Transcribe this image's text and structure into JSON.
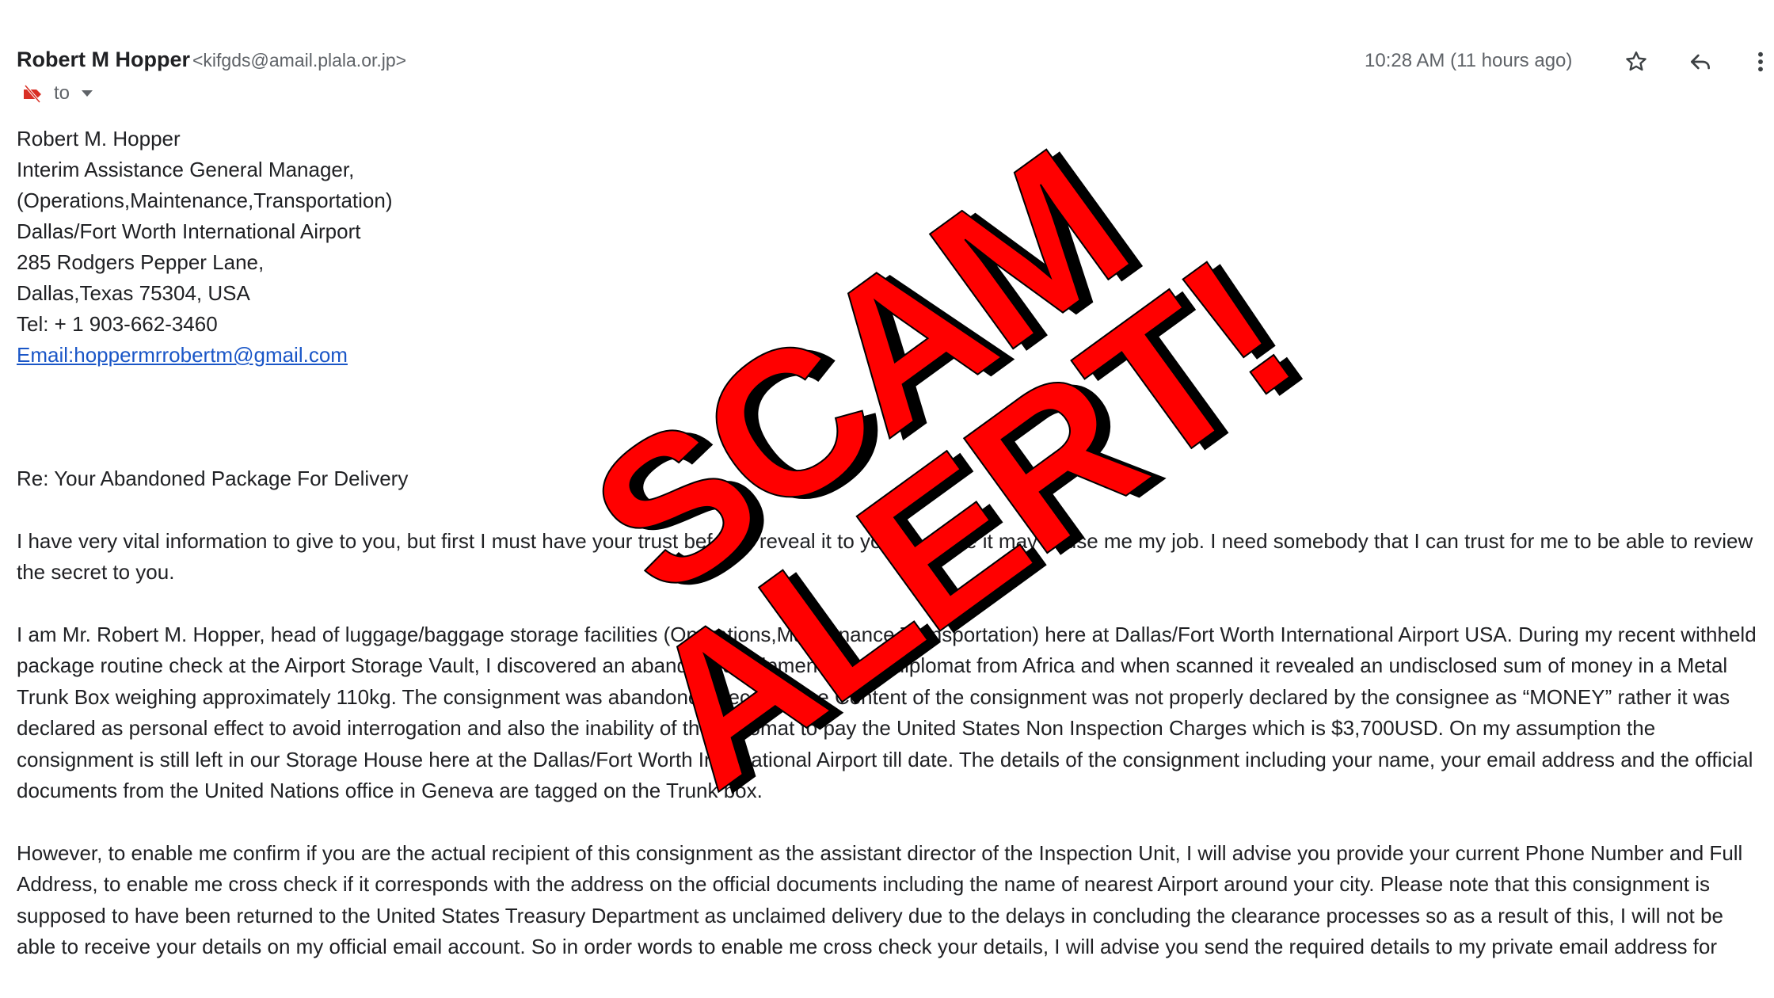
{
  "header": {
    "sender_name": "Robert M Hopper",
    "sender_email": "<kifgds@amail.plala.or.jp>",
    "timestamp": "10:28 AM (11 hours ago)",
    "recipient_label": "to"
  },
  "icons": {
    "star": "star-icon",
    "reply": "reply-icon",
    "more": "more-vertical-icon",
    "importance": "importance-marker-icon",
    "dropdown": "caret-down-icon"
  },
  "signature": {
    "lines": [
      "Robert M. Hopper",
      "Interim Assistance General Manager,",
      "(Operations,Maintenance,Transportation)",
      "Dallas/Fort Worth International Airport",
      "285 Rodgers Pepper Lane,",
      "Dallas,Texas 75304, USA",
      "Tel: + 1 903-662-3460"
    ],
    "email_link": "Email:hoppermrrobertm@gmail.com"
  },
  "body": {
    "subject": "Re: Your Abandoned Package For Delivery",
    "paragraphs": [
      "I have very vital information to give to you, but first I must have your trust before I reveal it to you because it may cause me my job. I need somebody that I can trust for me to be able to review the secret to you.",
      "I am Mr. Robert M. Hopper, head of luggage/baggage storage facilities (Operations,Maintenance,Transportation) here at Dallas/Fort Worth International Airport USA. During my recent withheld package routine check at the Airport Storage Vault, I discovered an abandoned shipment from a diplomat from Africa and when scanned it revealed an undisclosed sum of money in a Metal Trunk Box weighing approximately 110kg. The consignment was abandoned because the Content of the consignment was not properly declared by the consignee as “MONEY” rather it was declared as personal effect to avoid interrogation and also the inability of the diplomat to pay the United States Non Inspection Charges which is $3,700USD. On my assumption the consignment is still left in our Storage House here at the Dallas/Fort Worth International Airport till date. The details of the consignment including your name, your email address and the official documents from the United Nations office in Geneva are tagged on the Trunk box.",
      "However, to enable me confirm if you are the actual recipient of this consignment as the assistant director of the Inspection Unit, I will advise you provide your current Phone Number and Full Address, to enable me cross check if it corresponds with the address on the official documents including the name of nearest Airport around your city. Please note that this consignment is supposed to have been returned to the United States Treasury Department as unclaimed delivery due to the delays in concluding the clearance processes so as a result of this, I will not be able to receive your details on my official email account. So in order words to enable me cross check your details, I will advise you send the required details to my private email address for"
    ]
  },
  "stamp": {
    "line1": "SCAM",
    "line2": "ALERT!",
    "color": "#ff0000",
    "shadow_color": "#000000"
  },
  "colors": {
    "link": "#1a56c7",
    "muted": "#5f6368",
    "text": "#202124",
    "importance_marker": "#d93025"
  }
}
